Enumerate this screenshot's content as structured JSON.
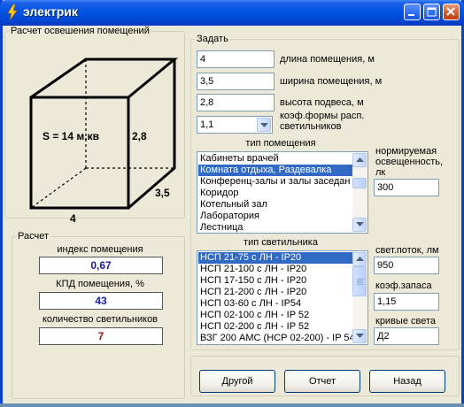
{
  "window": {
    "title": "электрик",
    "icon": "lightning-icon"
  },
  "room_section": {
    "legend": "Расчет освешения помещений",
    "area_text": "S = 14 м.кв",
    "dim_length": "4",
    "dim_height": "2,8",
    "dim_width": "3,5"
  },
  "input_section": {
    "legend": "Задать",
    "length_value": "4",
    "length_label": "длина помещения, м",
    "width_value": "3,5",
    "width_label": "ширина помещения, м",
    "height_value": "2,8",
    "height_label": "высота подвеса, м",
    "form_coef_value": "1,1",
    "form_coef_label_line1": "коэф.формы расп.",
    "form_coef_label_line2": "светильников",
    "room_type_label": "тип помещения",
    "room_types": [
      {
        "label": "Кабинеты врачей",
        "selected": false
      },
      {
        "label": "Комната отдыха, Раздевалка",
        "selected": true
      },
      {
        "label": "Конференц-залы и залы заседан",
        "selected": false
      },
      {
        "label": "Коридор",
        "selected": false
      },
      {
        "label": "Котельный зал",
        "selected": false
      },
      {
        "label": "Лаборатория",
        "selected": false
      },
      {
        "label": "Лестница",
        "selected": false
      }
    ],
    "norm_label_line1": "нормируемая",
    "norm_label_line2": "освещенность,",
    "norm_label_line3": "лк",
    "norm_value": "300",
    "lamp_type_label": "тип светильника",
    "lamp_types": [
      {
        "label": "НСП 21-75  с  ЛН - IP20",
        "selected": true
      },
      {
        "label": "НСП 21-100  с  ЛН - IP20",
        "selected": false
      },
      {
        "label": "НСП 17-150  с  ЛН - IP20",
        "selected": false
      },
      {
        "label": "НСП 21-200  с  ЛН - IP20",
        "selected": false
      },
      {
        "label": "НСП 03-60  с  ЛН - IP54",
        "selected": false
      },
      {
        "label": "НСП 02-100  с  ЛН - IP 52",
        "selected": false
      },
      {
        "label": "НСП 02-200  с  ЛН - IP 52",
        "selected": false
      },
      {
        "label": "ВЗГ 200 АМС (НСР 02-200)  - IP 54",
        "selected": false
      }
    ],
    "flux_label": "свет.поток, лм",
    "flux_value": "950",
    "reserve_label": "коэф.запаса",
    "reserve_value": "1,15",
    "curve_label": "кривые света",
    "curve_value": "Д2"
  },
  "calc_section": {
    "legend": "Расчет",
    "room_index_label": "индекс помещения",
    "room_index_value": "0,67",
    "room_index_color": "#1a1aa8",
    "efficiency_label": "КПД помещения, %",
    "efficiency_value": "43",
    "efficiency_color": "#1a1aa8",
    "count_label": "количество светильников",
    "count_value": "7",
    "count_color": "#a01010"
  },
  "buttons": {
    "other": "Другой",
    "report": "Отчет",
    "back": "Назад"
  }
}
